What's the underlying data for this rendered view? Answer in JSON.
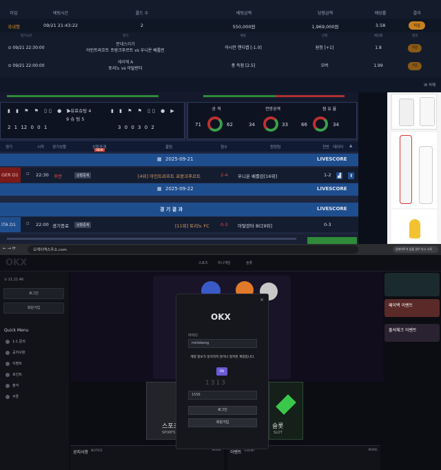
{
  "bet_history": {
    "headers": [
      "타입",
      "베팅시간",
      "폴드 수",
      "베팅금액",
      "당첨금액",
      "배당률",
      "결과"
    ],
    "summary": {
      "type": "국내형",
      "time": "09/21 21:43:22",
      "folds": "2",
      "amount": "550,000원",
      "win": "1,969,000원",
      "odds": "3.58",
      "result": "적중"
    },
    "sub_headers": [
      "경기시간",
      "경기",
      "베팅",
      "선택",
      "배당률",
      "결과"
    ],
    "bets": [
      {
        "time": "09/21 22:30:00",
        "league": "분데스리가",
        "match": "아인트라흐트 프랑크푸르트 vs 우니온 베를린",
        "bet": "아시안 핸디캡 [-1.0]",
        "pick": "원정 [+1]",
        "odds": "1.8",
        "result": "적중"
      },
      {
        "time": "09/21 22:00:00",
        "league": "세리에 A",
        "match": "토리노 vs 아탈란타",
        "bet": "총 득점 [2.5]",
        "pick": "오버",
        "odds": "1.99",
        "result": "적중"
      }
    ],
    "delete_label": "삭제"
  },
  "livescore": {
    "stats_left": {
      "row1": "7  유효슈팅  4",
      "row2": "9  슈  팅  5",
      "nums_left": "2  1  12  0  0  1",
      "nums_right": "3  0  0  3  0  2"
    },
    "stats": [
      {
        "label": "공 격",
        "home": "71",
        "away": "62"
      },
      {
        "label": "전방공격",
        "home": "34",
        "away": "33"
      },
      {
        "label": "점 유 율",
        "home": "66",
        "away": "34"
      }
    ],
    "headers": [
      "경기",
      "시작",
      "경기상황",
      "상황중계",
      "홈팀",
      "점수",
      "원정팀",
      "전반",
      "데이터"
    ],
    "new_badge": "NEW",
    "date1": "2025-09-21",
    "date2": "2025-09-22",
    "results_label": "경 기 결 과",
    "live_label": "LIVESCORE",
    "match1": {
      "league": "GER D1",
      "start": "22:30",
      "status": "후반",
      "home": "[4위] 아인트라흐트 프랑크푸르트",
      "score": "2-4",
      "away": "우니온 베를린[16위]",
      "half": "1-2"
    },
    "match2": {
      "league": "ITA D1",
      "start": "22:00",
      "status": "경기종료",
      "home": "[11위] 토리노 FC",
      "score": "0-3",
      "away": "아탈란타 BC[9위]",
      "half": "0-3"
    },
    "relay_label": "상황중계"
  },
  "browser": {
    "url": "오케이엑스주소.com",
    "profile": "업데이트가 있을 경우 다시 시작"
  },
  "site": {
    "logo": "OKX",
    "nav": [
      "스포츠",
      "미니게임",
      "슬롯"
    ],
    "time": "21:21:46",
    "login": "로그인",
    "signup": "회원가입",
    "quick_menu": "Quick Menu",
    "quick_items": [
      "1:1 문의",
      "공지사항",
      "이벤트",
      "포인트",
      "출석",
      "쿠폰"
    ],
    "modal": {
      "logo": "OKX",
      "id_label": "아이디",
      "id_value": "minbbong",
      "message": "계정 정보가 일치하지 않거나 정지된 계정입니다.",
      "ok": "Ok",
      "pw_value": "1556",
      "login": "로그인",
      "signup": "회원가입",
      "captcha": "1313"
    },
    "cards": [
      {
        "title": "스포츠",
        "sub": "SPORTS"
      },
      {
        "title": "슬롯",
        "sub": "SLOT"
      }
    ],
    "notice": "공지사항",
    "notice_en": "NOTICE",
    "event": "이벤트",
    "event_en": "EVENT",
    "more": "MORE",
    "promos": [
      "페이백 이벤트",
      "출석체크 이벤트"
    ]
  }
}
